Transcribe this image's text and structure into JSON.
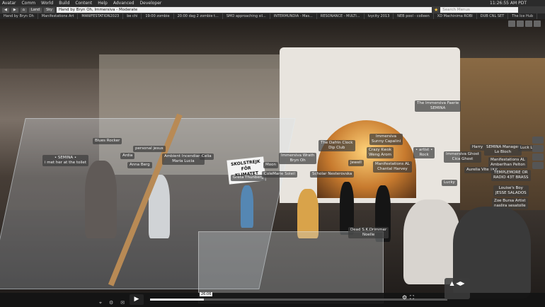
{
  "menu": [
    "Avatar",
    "Comm",
    "World",
    "Build",
    "Content",
    "Help",
    "Advanced",
    "Developer"
  ],
  "clock": "11:26:55 AM PDT",
  "nav": {
    "back": "◀",
    "forward": "▶",
    "home": "⌂",
    "land": "Land",
    "sky": "Sky"
  },
  "address": "Hand by Bryn Oh, Immersiva - Moderate",
  "search_placeholder": "Search Menus",
  "right_search_placeholder": "Search",
  "favorites": [
    "Hand by Bryn Oh",
    "Manifestations Art",
    "MANIFESTATION2023",
    "be chi",
    "19:00 zombie",
    "20:00 dag 2 zombie t...",
    "SMO approaching sil...",
    "INTERMUNDIA - Mas...",
    "RESONANCE - MULTI...",
    "Ivycity 2013",
    "NEB pool - colleen",
    "XD Machinima ROBI",
    "DUB CNL SET",
    "The Ice Hub"
  ],
  "sign": {
    "line1": "SKOLSTREJK",
    "line2": "FÖR",
    "line3": "KLIMATET"
  },
  "nametags": [
    {
      "id": "blues",
      "text": "Blues Rocker"
    },
    {
      "id": "semina1",
      "text": "• SEMINA •\ni met her at the toilet"
    },
    {
      "id": "personal",
      "text": "personal jesus"
    },
    {
      "id": "ardia",
      "text": "Ardia"
    },
    {
      "id": "ambient",
      "text": "Ambient Incendiary\nMaria Lucia"
    },
    {
      "id": "celia",
      "text": "Celia"
    },
    {
      "id": "anna",
      "text": "Anna Berg"
    },
    {
      "id": "greta",
      "text": "Greta Thunberg"
    },
    {
      "id": "immersiva",
      "text": "Immersiva Wrath\nBryn Oh"
    },
    {
      "id": "moon",
      "text": "Moon"
    },
    {
      "id": "colemarie",
      "text": "ColeMarie Soleil"
    },
    {
      "id": "scholar",
      "text": "Scholar Nesterovska"
    },
    {
      "id": "faerie",
      "text": "The Immersiva Faerie\nSEMINA"
    },
    {
      "id": "immersiva2",
      "text": "Immersiva\nSunny Capalini"
    },
    {
      "id": "dipclub",
      "text": "The Dafrin Clock\nDip Club"
    },
    {
      "id": "jewell",
      "text": "Jewell"
    },
    {
      "id": "crazy",
      "text": "Crazy Kwok\nWeng Arom"
    },
    {
      "id": "chantal",
      "text": "Manifestations AL\nChantal Harvey"
    },
    {
      "id": "rock",
      "text": "• artist •\nRock"
    },
    {
      "id": "cicaghost",
      "text": "Immersiva Ghost\nCica Ghost"
    },
    {
      "id": "aurelia",
      "text": "Aurelia Vite TKP"
    },
    {
      "id": "lucky",
      "text": "Lucky"
    },
    {
      "id": "dead",
      "text": "Dead S.K.Drimmer\nNoelle"
    },
    {
      "id": "harry",
      "text": "Harry"
    },
    {
      "id": "bloch",
      "text": "SEMINA Manager\nLo Bloch"
    },
    {
      "id": "luck",
      "text": "Luck Lo"
    },
    {
      "id": "manifest2",
      "text": "Manifestations AL\nAmberlhan Pelton"
    },
    {
      "id": "temple",
      "text": "TEMPLEMORE OR\nRADIO 43T BRASS"
    },
    {
      "id": "louise",
      "text": "Louise's Boy\nJESSE SALADOS"
    },
    {
      "id": "zoe",
      "text": "Zoe Bursa Artist\nnaslira sesatolle"
    }
  ],
  "player": {
    "play": "▶",
    "time": "26:06",
    "progress": 0.18
  }
}
